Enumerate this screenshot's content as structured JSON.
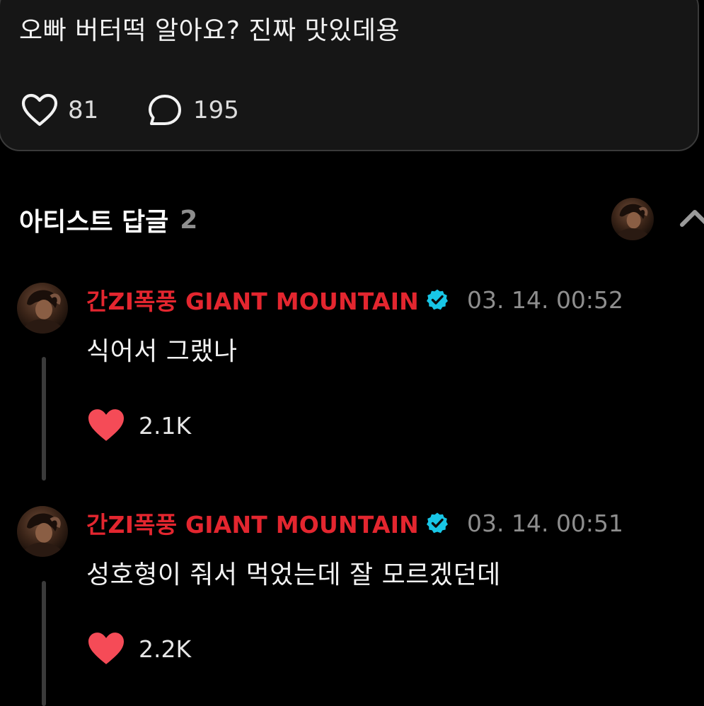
{
  "post": {
    "text": "오빠 버터떡 알아요? 진짜 맛있데용",
    "likes": "81",
    "comments": "195",
    "like_icon": "heart-outline-icon",
    "comment_icon": "speech-bubble-icon"
  },
  "artist_replies": {
    "title": "아티스트 답글",
    "count": "2",
    "collapse_icon": "chevron-up-icon",
    "replies": [
      {
        "author": "간ZI폭풍 GIANT MOUNTAIN",
        "verified_icon": "verified-badge-icon",
        "timestamp": "03. 14. 00:52",
        "text": "식어서 그랬나",
        "likes": "2.1K",
        "like_icon": "heart-filled-icon"
      },
      {
        "author": "간ZI폭풍 GIANT MOUNTAIN",
        "verified_icon": "verified-badge-icon",
        "timestamp": "03. 14. 00:51",
        "text": "성호형이 줘서 먹었는데 잘 모르겠던데",
        "likes": "2.2K",
        "like_icon": "heart-filled-icon"
      }
    ]
  },
  "colors": {
    "background": "#000000",
    "card": "#161616",
    "artist_name": "#e3262f",
    "verified": "#18c6e6",
    "like_filled": "#f54b57",
    "muted": "#8e8e8e"
  }
}
